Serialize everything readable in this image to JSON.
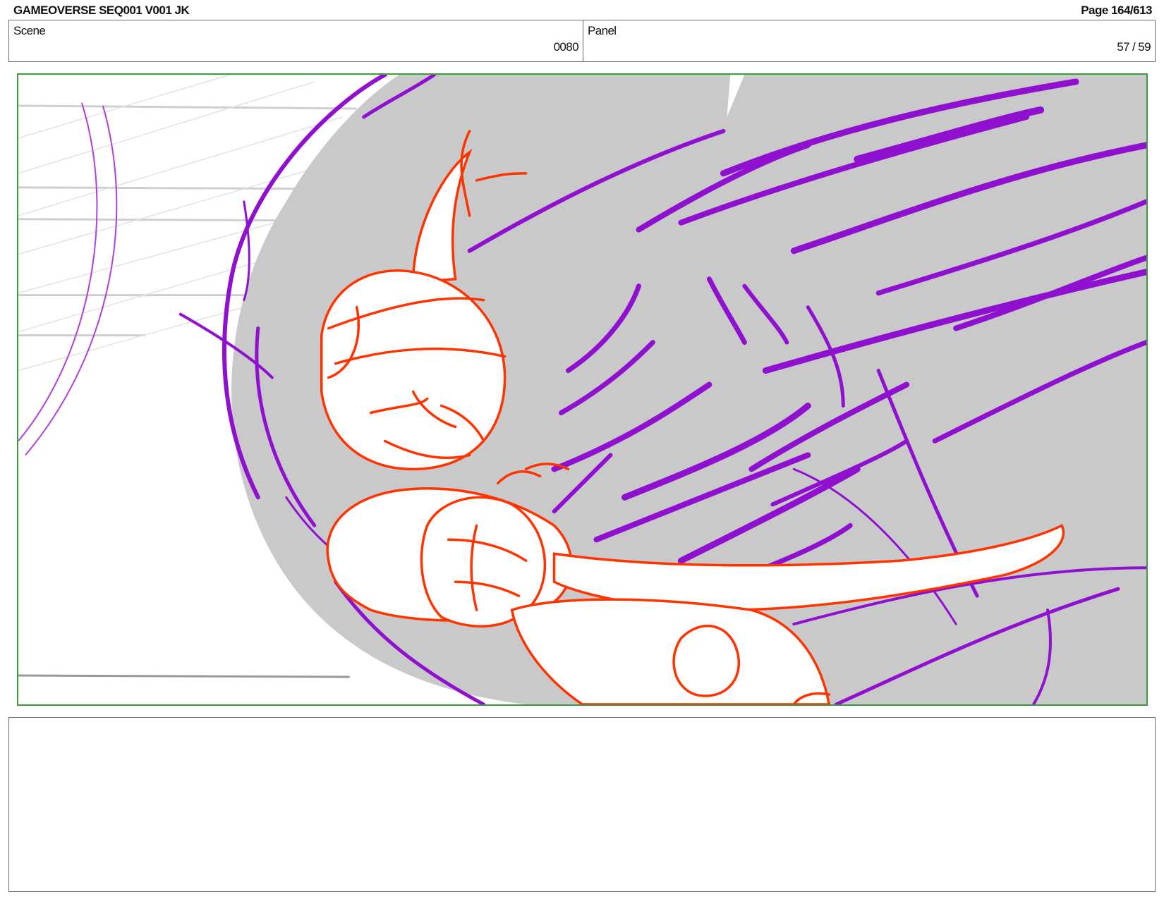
{
  "header": {
    "title": "GAMEOVERSE SEQ001 V001 JK",
    "page": "Page 164/613"
  },
  "info": {
    "scene_label": "Scene",
    "scene_value": "0080",
    "panel_label": "Panel",
    "panel_value": "57 / 59"
  },
  "frame": {
    "border_color": "#3f9a3f",
    "colors": {
      "fill": "#c9c9c9",
      "stroke_purple": "#9010d0",
      "stroke_red": "#ff3300",
      "guide_gray": "#cfcfcf"
    }
  },
  "notes": {
    "text": ""
  }
}
